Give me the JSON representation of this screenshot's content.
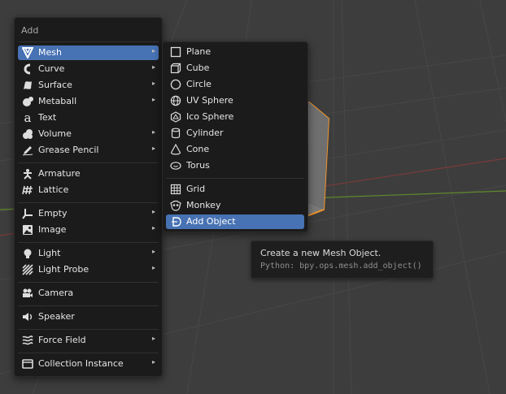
{
  "add_menu": {
    "title": "Add",
    "items": [
      {
        "label": "Mesh",
        "icon": "mesh-icon",
        "submenu": true,
        "active": true
      },
      {
        "label": "Curve",
        "icon": "curve-icon",
        "submenu": true
      },
      {
        "label": "Surface",
        "icon": "surface-icon",
        "submenu": true
      },
      {
        "label": "Metaball",
        "icon": "metaball-icon",
        "submenu": true
      },
      {
        "label": "Text",
        "icon": "text-icon",
        "submenu": false
      },
      {
        "label": "Volume",
        "icon": "volume-icon",
        "submenu": true
      },
      {
        "label": "Grease Pencil",
        "icon": "grease-pencil-icon",
        "submenu": true
      },
      {
        "label": "Armature",
        "icon": "armature-icon",
        "submenu": false
      },
      {
        "label": "Lattice",
        "icon": "lattice-icon",
        "submenu": false
      },
      {
        "label": "Empty",
        "icon": "empty-icon",
        "submenu": true
      },
      {
        "label": "Image",
        "icon": "image-icon",
        "submenu": true
      },
      {
        "label": "Light",
        "icon": "light-icon",
        "submenu": true
      },
      {
        "label": "Light Probe",
        "icon": "light-probe-icon",
        "submenu": true
      },
      {
        "label": "Camera",
        "icon": "camera-icon",
        "submenu": false
      },
      {
        "label": "Speaker",
        "icon": "speaker-icon",
        "submenu": false
      },
      {
        "label": "Force Field",
        "icon": "force-field-icon",
        "submenu": true
      },
      {
        "label": "Collection Instance",
        "icon": "collection-icon",
        "submenu": true
      }
    ]
  },
  "mesh_menu": {
    "items": [
      {
        "label": "Plane",
        "icon": "plane-icon"
      },
      {
        "label": "Cube",
        "icon": "cube-icon"
      },
      {
        "label": "Circle",
        "icon": "circle-icon"
      },
      {
        "label": "UV Sphere",
        "icon": "uv-sphere-icon"
      },
      {
        "label": "Ico Sphere",
        "icon": "ico-sphere-icon"
      },
      {
        "label": "Cylinder",
        "icon": "cylinder-icon"
      },
      {
        "label": "Cone",
        "icon": "cone-icon"
      },
      {
        "label": "Torus",
        "icon": "torus-icon"
      },
      {
        "label": "Grid",
        "icon": "grid-icon"
      },
      {
        "label": "Monkey",
        "icon": "monkey-icon"
      },
      {
        "label": "Add Object",
        "icon": "add-object-icon",
        "active": true
      }
    ]
  },
  "tooltip": {
    "description": "Create a new Mesh Object.",
    "python": "Python: bpy.ops.mesh.add_object()"
  },
  "colors": {
    "viewport_bg": "#3d3d3d",
    "menu_bg": "#1b1b1b",
    "highlight": "#4772b3",
    "selection_outline": "#f0932a",
    "x_axis": "#7a3a3a",
    "y_axis": "#5f8a2c"
  },
  "submenu_arrow": "▸"
}
